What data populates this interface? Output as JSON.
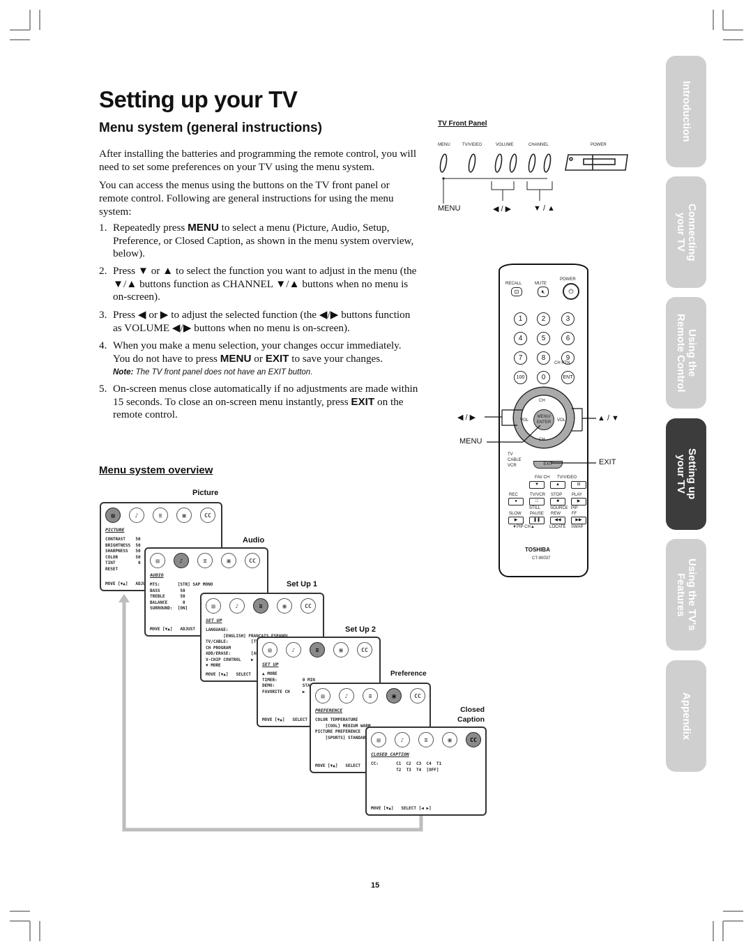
{
  "page": {
    "title": "Setting up your TV",
    "section_title": "Menu system (general instructions)",
    "intro_paragraphs": [
      "After installing the batteries and programming the remote control, you will need to set some preferences on your TV using the menu system.",
      "You can access the menus using the buttons on the TV front panel or remote control. Following are general instructions for using the menu system:"
    ],
    "steps": [
      {
        "num": "1.",
        "pre": "Repeatedly press ",
        "key": "MENU",
        "post": " to select a menu (Picture, Audio, Setup, Preference, or Closed Caption, as shown in the menu system overview, below)."
      },
      {
        "num": "2.",
        "text": "Press ▼ or ▲ to select the function you want to adjust in the menu (the ▼/▲ buttons function as CHANNEL ▼/▲ buttons when no menu is on-screen)."
      },
      {
        "num": "3.",
        "text": "Press ◀ or ▶ to adjust the selected function (the ◀/▶ buttons function as VOLUME ◀/▶ buttons when no menu is on-screen)."
      },
      {
        "num": "4.",
        "pre": "When you make a menu selection, your changes occur immediately. You do not have to press ",
        "key": "MENU",
        "mid": " or ",
        "key2": "EXIT",
        "post": " to save your changes.",
        "note_label": "Note:",
        "note": " The TV front panel does not have an EXIT button."
      },
      {
        "num": "5.",
        "pre": "On-screen menus close automatically if no adjustments are made within 15 seconds. To close an on-screen menu instantly, press ",
        "key": "EXIT",
        "post": " on the remote control."
      }
    ],
    "overview_title": "Menu system overview",
    "page_number": "15"
  },
  "front_panel": {
    "title": "TV Front Panel",
    "button_labels": [
      "MENU",
      "TV/VIDEO",
      "VOLUME",
      "CHANNEL",
      "POWER"
    ],
    "callouts": [
      "MENU",
      "◀ / ▶",
      "▼ / ▲"
    ]
  },
  "remote": {
    "top_labels": [
      "RECALL",
      "MUTE",
      "POWER"
    ],
    "digits": [
      "1",
      "2",
      "3",
      "4",
      "5",
      "6",
      "7",
      "8",
      "9",
      "100",
      "0",
      "ENT"
    ],
    "ch_rtn": "CH RTN",
    "dpad": {
      "up": "CH",
      "down": "CH",
      "left": "VOL",
      "right": "VOL",
      "center": "MENU/\nENTER"
    },
    "switch": [
      "TV",
      "CABLE",
      "VCR"
    ],
    "exit": "EXIT",
    "row_fav": [
      "FAV CH",
      "TV/VIDEO"
    ],
    "row1": [
      "REC",
      "TV/VCR",
      "STOP",
      "PLAY"
    ],
    "row1_sub": [
      "STILL",
      "SOURCE",
      "PIP"
    ],
    "row2": [
      "SLOW",
      "PAUSE",
      "REW",
      "FF"
    ],
    "row2_sub": [
      "▼PIP CH▲",
      "LOCATE",
      "SWAP"
    ],
    "brand": "TOSHIBA",
    "model": "CT-90037",
    "callouts": {
      "left_right": "◀ / ▶",
      "up_down": "▲ / ▼",
      "menu": "MENU",
      "exit": "EXIT"
    }
  },
  "menus": [
    {
      "label": "Picture",
      "header": "PICTURE",
      "selected": 0,
      "rows": "CONTRAST    50\nBRIGHTNESS  50\nSHARPNESS   50\nCOLOR       50\nTINT         0\nRESET",
      "footer": "MOVE [▼▲]   ADJUST [◀ ▶]"
    },
    {
      "label": "Audio",
      "header": "AUDIO",
      "selected": 1,
      "rows": "MTS:       [STR] SAP MONO\nBASS        50\nTREBLE      50\nBALANCE      0\nSURROUND:  [ON]",
      "footer": "MOVE [▼▲]   ADJUST"
    },
    {
      "label": "Set Up 1",
      "header": "SET UP",
      "selected": 2,
      "rows": "LANGUAGE:\n       [ENGLISH] FRANCAIS ESPANOL\nTV/CABLE:         [TV]\nCH PROGRAM\nADD/ERASE:        [ADD]\nV-CHIP CONTROL    ▶\n▼ MORE",
      "footer": "MOVE [▼▲]   SELECT"
    },
    {
      "label": "Set Up 2",
      "header": "SET UP",
      "selected": 2,
      "rows": "▲ MORE\nTIMER:          0 MIN\nDEMO:           START\nFAVORITE CH     ▶",
      "footer": "MOVE [▼▲]   SELECT"
    },
    {
      "label": "Preference",
      "header": "PREFERENCE",
      "selected": 3,
      "rows": "COLOR TEMPERATURE\n    [COOL] MEDIUM WARM\nPICTURE PREFERENCE\n    [SPORTS] STANDARD",
      "footer": "MOVE [▼▲]   SELECT"
    },
    {
      "label": "Closed\nCaption",
      "header": "CLOSED CAPTION",
      "selected": 4,
      "rows": "CC:       C1  C2  C3  C4  T1\n          T2  T3  T4  [OFF]",
      "footer": "MOVE [▼▲]   SELECT [◀ ▶]"
    }
  ],
  "menu_icons": [
    "picture-icon",
    "audio-icon",
    "setup-icon",
    "preference-icon",
    "closed-caption-icon"
  ],
  "menu_icon_glyphs": [
    "▤",
    "♪",
    "≡",
    "▣",
    "CC"
  ],
  "side_tabs": [
    {
      "label": "Introduction",
      "active": false
    },
    {
      "label": "Connecting\nyour TV",
      "active": false
    },
    {
      "label": "Using the\nRemote Control",
      "active": false
    },
    {
      "label": "Setting up\nyour TV",
      "active": true
    },
    {
      "label": "Using the TV's\nFeatures",
      "active": false
    },
    {
      "label": "Appendix",
      "active": false
    }
  ]
}
